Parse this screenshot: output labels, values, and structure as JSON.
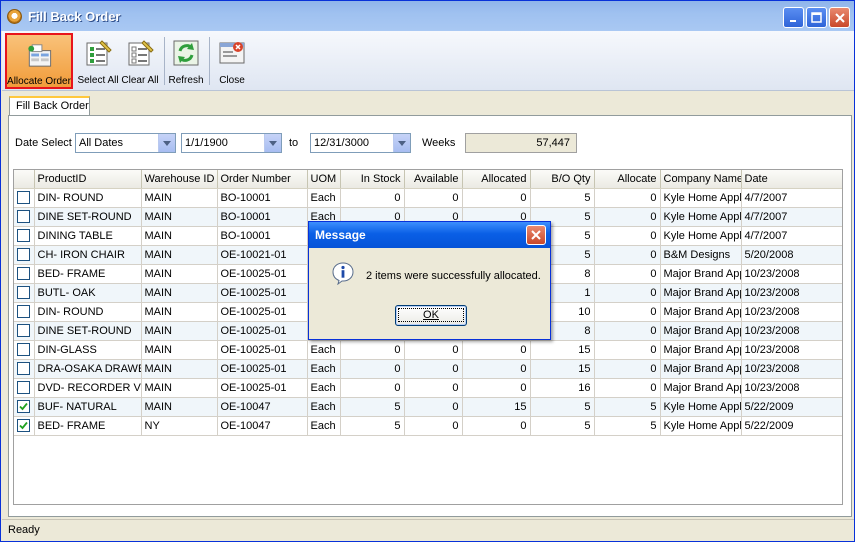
{
  "window": {
    "title": "Fill Back Order"
  },
  "toolbar": {
    "allocate_label": "Allocate Order",
    "select_all_label": "Select All",
    "clear_all_label": "Clear All",
    "refresh_label": "Refresh",
    "close_label": "Close"
  },
  "tab": {
    "label": "Fill Back Order"
  },
  "filter": {
    "date_select_label": "Date Select",
    "date_select_value": "All Dates",
    "from_value": "1/1/1900",
    "to_label": "to",
    "to_value": "12/31/3000",
    "weeks_label": "Weeks",
    "weeks_value": "57,447"
  },
  "grid": {
    "headers": [
      "ProductID",
      "Warehouse ID",
      "Order Number",
      "UOM",
      "In Stock",
      "Available",
      "Allocated",
      "B/O Qty",
      "Allocate",
      "Company Name",
      "Date"
    ],
    "rows": [
      {
        "checked": false,
        "product": "DIN- ROUND",
        "wh": "MAIN",
        "order": "BO-10001",
        "uom": "Each",
        "stock": "0",
        "avail": "0",
        "alloc": "0",
        "bo": "5",
        "allocate": "0",
        "company": "Kyle Home Appli",
        "date": "4/7/2007"
      },
      {
        "checked": false,
        "product": "DINE SET-ROUND",
        "wh": "MAIN",
        "order": "BO-10001",
        "uom": "Each",
        "stock": "0",
        "avail": "0",
        "alloc": "0",
        "bo": "5",
        "allocate": "0",
        "company": "Kyle Home Appli",
        "date": "4/7/2007"
      },
      {
        "checked": false,
        "product": "DINING TABLE",
        "wh": "MAIN",
        "order": "BO-10001",
        "uom": "",
        "stock": "",
        "avail": "",
        "alloc": "",
        "bo": "5",
        "allocate": "0",
        "company": "Kyle Home Appli",
        "date": "4/7/2007"
      },
      {
        "checked": false,
        "product": "CH- IRON CHAIR",
        "wh": "MAIN",
        "order": "OE-10021-01",
        "uom": "",
        "stock": "",
        "avail": "",
        "alloc": "",
        "bo": "5",
        "allocate": "0",
        "company": "B&M Designs",
        "date": "5/20/2008"
      },
      {
        "checked": false,
        "product": "BED- FRAME",
        "wh": "MAIN",
        "order": "OE-10025-01",
        "uom": "",
        "stock": "",
        "avail": "",
        "alloc": "",
        "bo": "8",
        "allocate": "0",
        "company": "Major Brand App",
        "date": "10/23/2008"
      },
      {
        "checked": false,
        "product": "BUTL- OAK",
        "wh": "MAIN",
        "order": "OE-10025-01",
        "uom": "",
        "stock": "",
        "avail": "",
        "alloc": "",
        "bo": "1",
        "allocate": "0",
        "company": "Major Brand App",
        "date": "10/23/2008"
      },
      {
        "checked": false,
        "product": "DIN- ROUND",
        "wh": "MAIN",
        "order": "OE-10025-01",
        "uom": "",
        "stock": "",
        "avail": "",
        "alloc": "",
        "bo": "10",
        "allocate": "0",
        "company": "Major Brand App",
        "date": "10/23/2008"
      },
      {
        "checked": false,
        "product": "DINE SET-ROUND",
        "wh": "MAIN",
        "order": "OE-10025-01",
        "uom": "",
        "stock": "",
        "avail": "",
        "alloc": "",
        "bo": "8",
        "allocate": "0",
        "company": "Major Brand App",
        "date": "10/23/2008"
      },
      {
        "checked": false,
        "product": "DIN-GLASS",
        "wh": "MAIN",
        "order": "OE-10025-01",
        "uom": "Each",
        "stock": "0",
        "avail": "0",
        "alloc": "0",
        "bo": "15",
        "allocate": "0",
        "company": "Major Brand App",
        "date": "10/23/2008"
      },
      {
        "checked": false,
        "product": "DRA-OSAKA DRAWEF",
        "wh": "MAIN",
        "order": "OE-10025-01",
        "uom": "Each",
        "stock": "0",
        "avail": "0",
        "alloc": "0",
        "bo": "15",
        "allocate": "0",
        "company": "Major Brand App",
        "date": "10/23/2008"
      },
      {
        "checked": false,
        "product": "DVD- RECORDER VCF",
        "wh": "MAIN",
        "order": "OE-10025-01",
        "uom": "Each",
        "stock": "0",
        "avail": "0",
        "alloc": "0",
        "bo": "16",
        "allocate": "0",
        "company": "Major Brand App",
        "date": "10/23/2008"
      },
      {
        "checked": true,
        "product": "BUF- NATURAL",
        "wh": "MAIN",
        "order": "OE-10047",
        "uom": "Each",
        "stock": "5",
        "avail": "0",
        "alloc": "15",
        "bo": "5",
        "allocate": "5",
        "company": "Kyle Home Appli",
        "date": "5/22/2009"
      },
      {
        "checked": true,
        "product": "BED- FRAME",
        "wh": "NY",
        "order": "OE-10047",
        "uom": "Each",
        "stock": "5",
        "avail": "0",
        "alloc": "0",
        "bo": "5",
        "allocate": "5",
        "company": "Kyle Home Appli",
        "date": "5/22/2009"
      }
    ]
  },
  "status": {
    "text": "Ready"
  },
  "dialog": {
    "title": "Message",
    "message": "2 items were successfully allocated.",
    "ok_label": "OK"
  }
}
